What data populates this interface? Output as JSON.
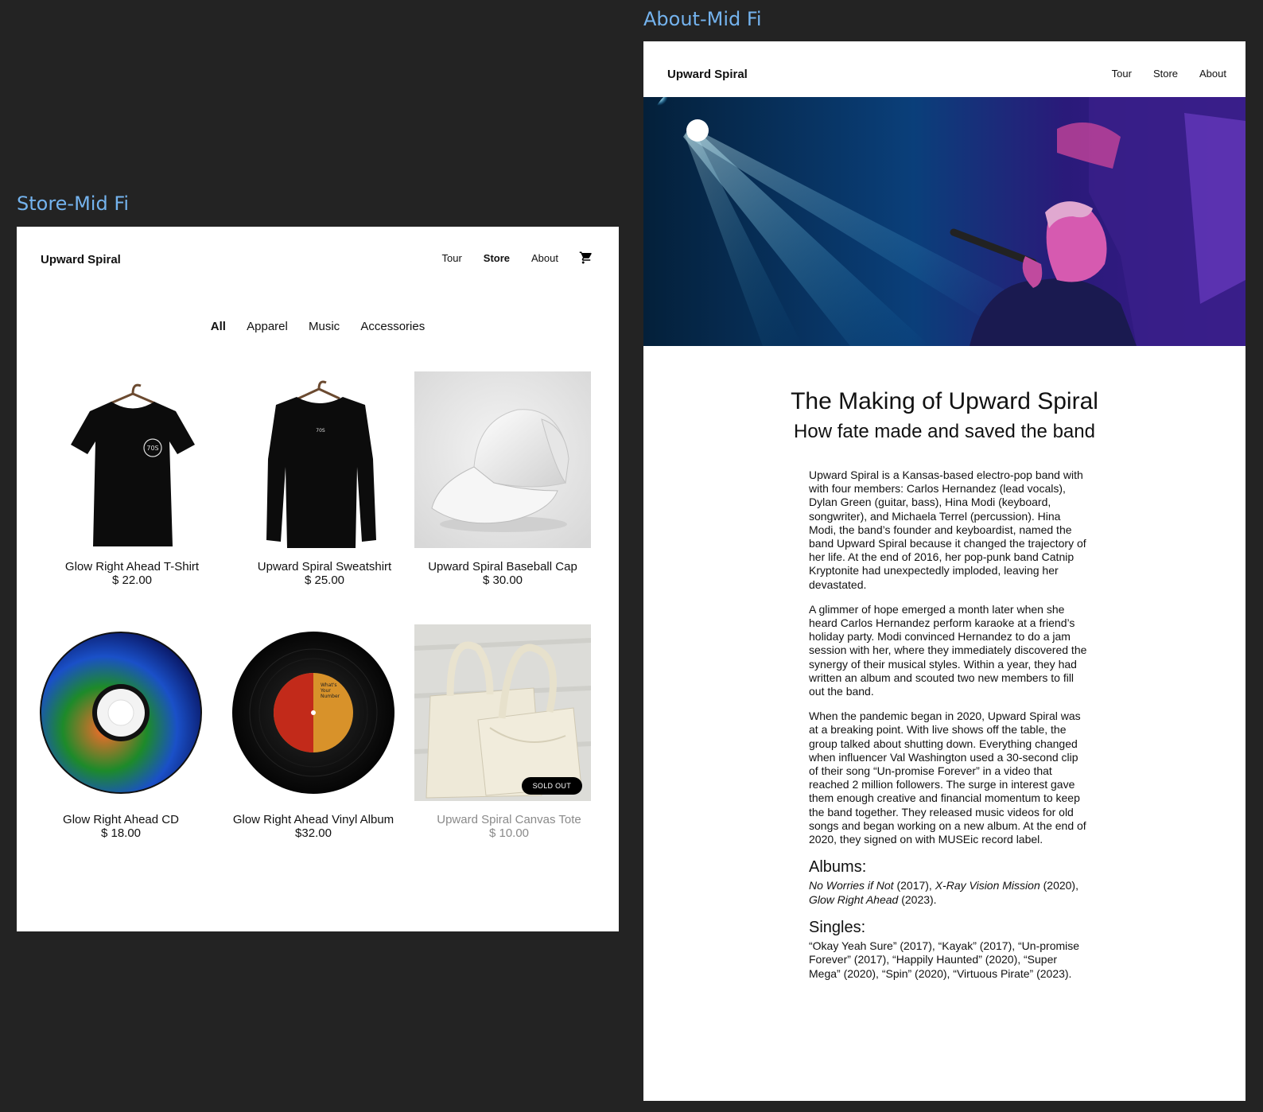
{
  "labels": {
    "store_frame": "Store-Mid Fi",
    "about_frame": "About-Mid Fi"
  },
  "store": {
    "brand": "Upward Spiral",
    "nav": [
      "Tour",
      "Store",
      "About"
    ],
    "nav_active": "Store",
    "cart_icon": "shopping-cart-icon",
    "filters": [
      "All",
      "Apparel",
      "Music",
      "Accessories"
    ],
    "filter_active": "All",
    "products": [
      {
        "name": "Glow Right Ahead T-Shirt",
        "price": "$ 22.00",
        "emblem": "70S"
      },
      {
        "name": "Upward Spiral Sweatshirt",
        "price": "$ 25.00",
        "emblem": "70S"
      },
      {
        "name": "Upward Spiral Baseball Cap",
        "price": "$ 30.00"
      },
      {
        "name": "Glow Right Ahead CD",
        "price": "$ 18.00"
      },
      {
        "name": "Glow Right Ahead Vinyl Album",
        "price": "$32.00"
      },
      {
        "name": "Upward Spiral Canvas Tote",
        "price": "$ 10.00",
        "badge": "SOLD OUT"
      }
    ]
  },
  "about": {
    "brand": "Upward Spiral",
    "nav": [
      "Tour",
      "Store",
      "About"
    ],
    "title": "The Making of Upward Spiral",
    "subtitle": "How fate made and saved the band",
    "paragraphs": [
      "Upward Spiral is a Kansas-based electro-pop band with with four members: Carlos Hernandez (lead vocals), Dylan Green (guitar, bass), Hina Modi (keyboard, songwriter), and Michaela Terrel (percussion). Hina Modi, the band’s founder and keyboardist, named the band Upward Spiral because it changed the trajectory of her life. At the end of 2016, her pop-punk band Catnip Kryptonite had unexpectedly imploded, leaving her devastated.",
      "A glimmer of hope emerged a month later when she heard Carlos Hernandez perform karaoke at a friend’s holiday party. Modi convinced Hernandez to do a jam session with her, where they immediately discovered the synergy of their musical styles. Within a year, they had written an album and scouted two new members to fill out the band.",
      "When the pandemic began in 2020, Upward Spiral was at a breaking point. With live shows off the table, the group talked about shutting down. Everything changed when influencer Val Washington used a 30-second clip of their song “Un-promise Forever” in a video that reached 2 million followers. The surge in interest gave them enough creative and financial momentum to keep the band together. They released music videos for old songs and began working on a new album. At the end of 2020, they signed on with MUSEic record label."
    ],
    "albums_heading": "Albums:",
    "albums": {
      "a1": "No Worries if Not",
      "y1": " (2017), ",
      "a2": "X-Ray Vision Mission",
      "y2": " (2020), ",
      "a3": "Glow Right Ahead",
      "y3": " (2023)."
    },
    "singles_heading": "Singles:",
    "singles": "“Okay Yeah Sure” (2017), “Kayak” (2017), “Un-promise Forever” (2017), “Happily Haunted” (2020), “Super Mega” (2020), “Spin” (2020), “Virtuous Pirate” (2023).",
    "vinyl_label": [
      "What's",
      "Your",
      "Number"
    ]
  }
}
